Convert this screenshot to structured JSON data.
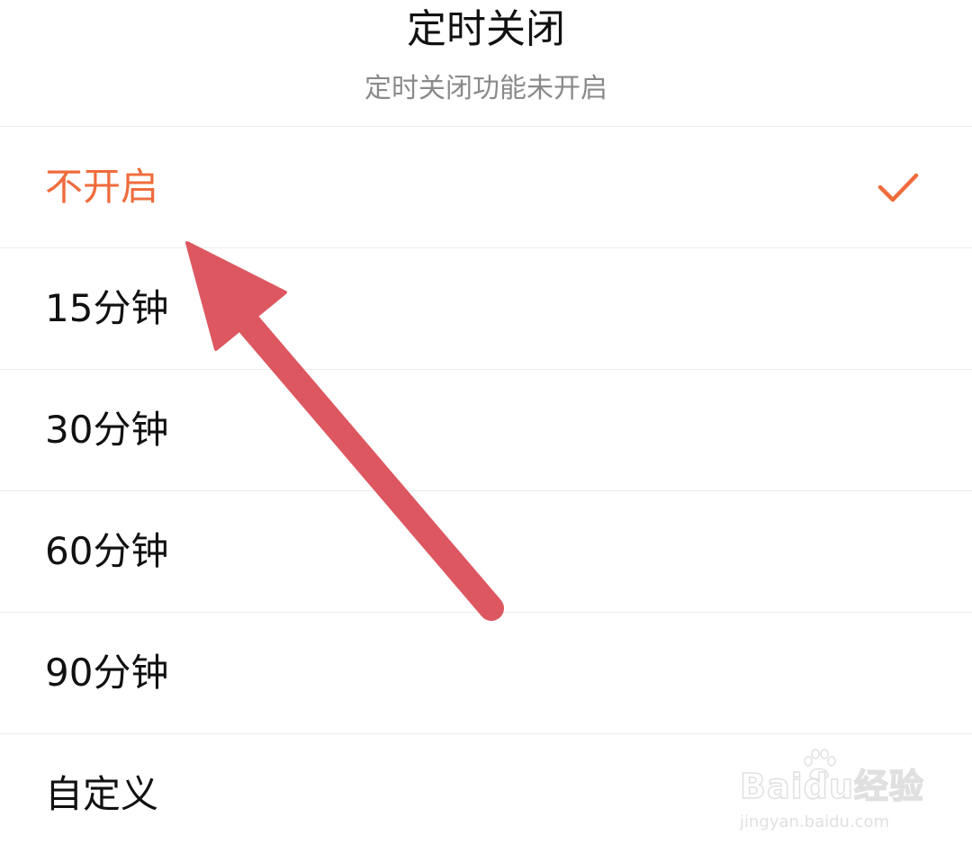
{
  "dialog": {
    "title": "定时关闭",
    "subtitle": "定时关闭功能未开启"
  },
  "options": [
    {
      "label": "不开启",
      "selected": true
    },
    {
      "label": "15分钟",
      "selected": false
    },
    {
      "label": "30分钟",
      "selected": false
    },
    {
      "label": "60分钟",
      "selected": false
    },
    {
      "label": "90分钟",
      "selected": false
    },
    {
      "label": "自定义",
      "selected": false
    }
  ],
  "selected_icon": "check-icon",
  "colors": {
    "accent": "#ef6c3c",
    "arrow": "#dd5760",
    "text": "#111111",
    "subtext": "#8a8a8a",
    "divider": "#ececec"
  },
  "watermark": {
    "brand": "Baidu经验",
    "url": "jingyan.baidu.com"
  }
}
